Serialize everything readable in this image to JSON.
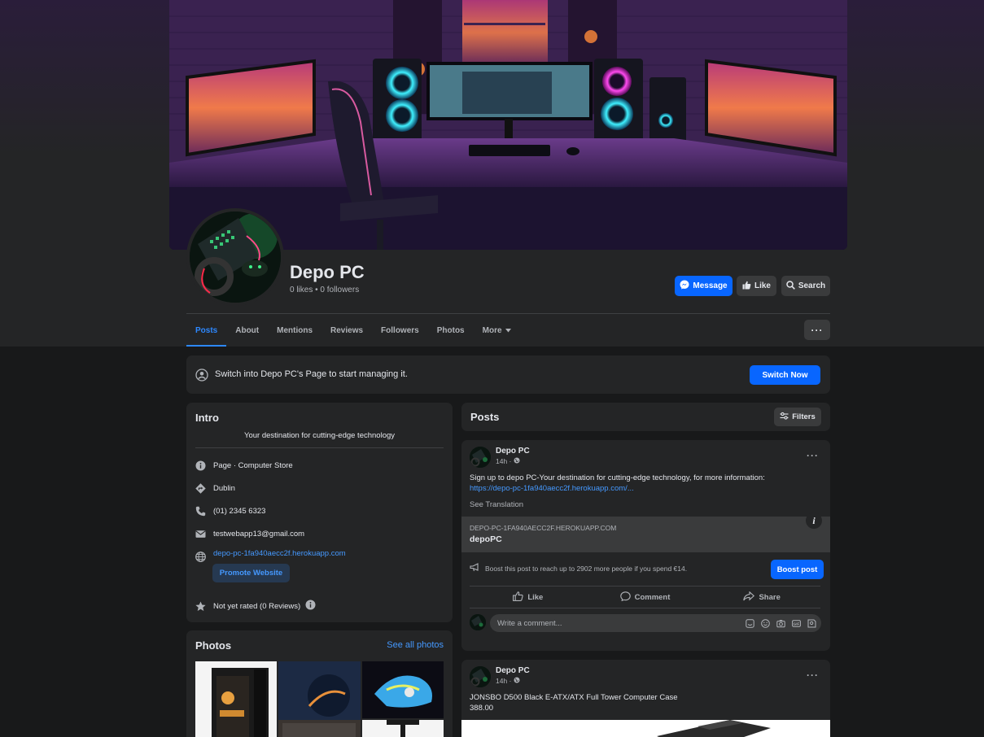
{
  "page": {
    "name": "Depo PC",
    "stats": "0 likes • 0 followers"
  },
  "header_buttons": {
    "message": "Message",
    "like": "Like",
    "search": "Search"
  },
  "tabs": [
    {
      "label": "Posts",
      "active": true
    },
    {
      "label": "About"
    },
    {
      "label": "Mentions"
    },
    {
      "label": "Reviews"
    },
    {
      "label": "Followers"
    },
    {
      "label": "Photos"
    },
    {
      "label": "More"
    }
  ],
  "switch_banner": {
    "text": "Switch into Depo PC's Page to start managing it.",
    "button": "Switch Now"
  },
  "intro": {
    "title": "Intro",
    "bio": "Your destination for cutting-edge technology",
    "category": "Page · Computer Store",
    "location": "Dublin",
    "phone": "(01) 2345 6323",
    "email": "testwebapp13@gmail.com",
    "website": "depo-pc-1fa940aecc2f.herokuapp.com",
    "promote_button": "Promote Website",
    "rating": "Not yet rated (0 Reviews)"
  },
  "photos": {
    "title": "Photos",
    "see_all": "See all photos"
  },
  "posts_section": {
    "title": "Posts",
    "filters": "Filters"
  },
  "post1": {
    "author": "Depo PC",
    "time": "14h ·",
    "text": "Sign up to depo PC-Your destination for cutting-edge technology, for more information:",
    "link": "https://depo-pc-1fa940aecc2f.herokuapp.com/...",
    "see_translation": "See Translation",
    "preview_domain": "DEPO-PC-1FA940AECC2F.HEROKUAPP.COM",
    "preview_title": "depoPC",
    "boost_text": "Boost this post to reach up to 2902 more people if you spend €14.",
    "boost_button": "Boost post",
    "actions": {
      "like": "Like",
      "comment": "Comment",
      "share": "Share"
    },
    "comment_placeholder": "Write a comment..."
  },
  "post2": {
    "author": "Depo PC",
    "time": "14h ·",
    "line1": "JONSBO D500 Black E-ATX/ATX Full Tower Computer Case",
    "line2": "388.00"
  },
  "colors": {
    "accent": "#0866ff",
    "link": "#4599ff",
    "card": "#242526",
    "background": "#18191a"
  }
}
